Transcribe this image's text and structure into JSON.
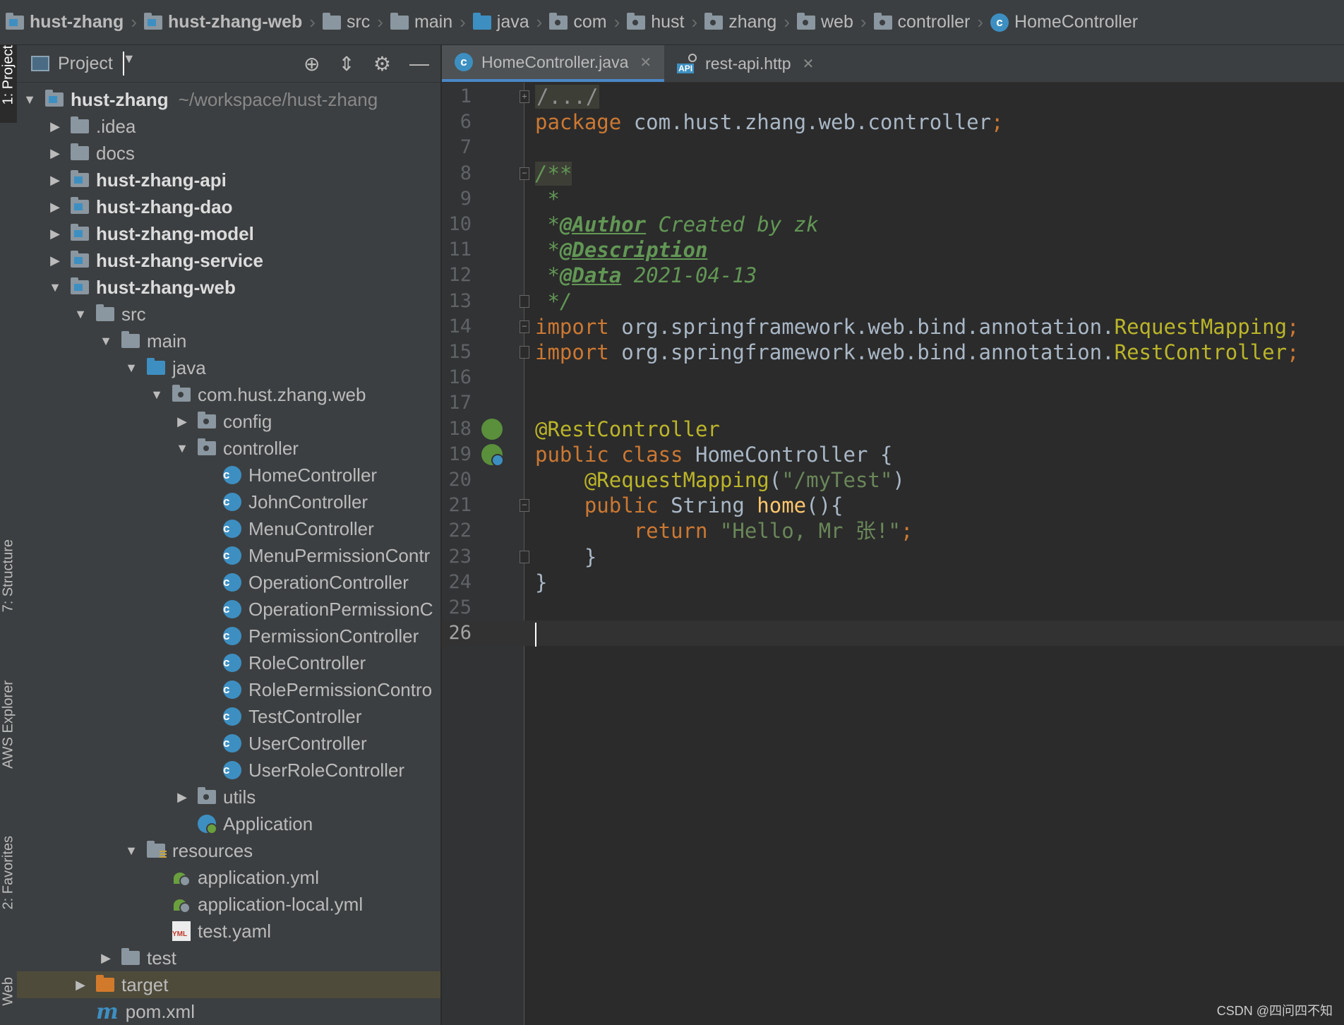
{
  "breadcrumb": [
    {
      "label": "hust-zhang",
      "icon": "module-folder-icon",
      "bold": true
    },
    {
      "label": "hust-zhang-web",
      "icon": "module-folder-icon",
      "bold": true
    },
    {
      "label": "src",
      "icon": "folder-icon"
    },
    {
      "label": "main",
      "icon": "folder-icon"
    },
    {
      "label": "java",
      "icon": "source-folder-icon"
    },
    {
      "label": "com",
      "icon": "package-icon"
    },
    {
      "label": "hust",
      "icon": "package-icon"
    },
    {
      "label": "zhang",
      "icon": "package-icon"
    },
    {
      "label": "web",
      "icon": "package-icon"
    },
    {
      "label": "controller",
      "icon": "package-icon"
    },
    {
      "label": "HomeController",
      "icon": "class-icon"
    }
  ],
  "side_tabs": {
    "project": "1: Project",
    "structure": "7: Structure",
    "aws": "AWS Explorer",
    "favorites": "2: Favorites",
    "web": "Web"
  },
  "project_panel": {
    "title": "Project",
    "tree": [
      {
        "label": "hust-zhang",
        "path": "~/workspace/hust-zhang",
        "depth": 0,
        "arrow": "down",
        "icon": "module",
        "bold": true
      },
      {
        "label": ".idea",
        "depth": 1,
        "arrow": "right",
        "icon": "folder"
      },
      {
        "label": "docs",
        "depth": 1,
        "arrow": "right",
        "icon": "folder"
      },
      {
        "label": "hust-zhang-api",
        "depth": 1,
        "arrow": "right",
        "icon": "module",
        "bold": true
      },
      {
        "label": "hust-zhang-dao",
        "depth": 1,
        "arrow": "right",
        "icon": "module",
        "bold": true
      },
      {
        "label": "hust-zhang-model",
        "depth": 1,
        "arrow": "right",
        "icon": "module",
        "bold": true
      },
      {
        "label": "hust-zhang-service",
        "depth": 1,
        "arrow": "right",
        "icon": "module",
        "bold": true
      },
      {
        "label": "hust-zhang-web",
        "depth": 1,
        "arrow": "down",
        "icon": "module",
        "bold": true
      },
      {
        "label": "src",
        "depth": 2,
        "arrow": "down",
        "icon": "folder"
      },
      {
        "label": "main",
        "depth": 3,
        "arrow": "down",
        "icon": "folder"
      },
      {
        "label": "java",
        "depth": 4,
        "arrow": "down",
        "icon": "source"
      },
      {
        "label": "com.hust.zhang.web",
        "depth": 5,
        "arrow": "down",
        "icon": "package"
      },
      {
        "label": "config",
        "depth": 6,
        "arrow": "right",
        "icon": "package"
      },
      {
        "label": "controller",
        "depth": 6,
        "arrow": "down",
        "icon": "package"
      },
      {
        "label": "HomeController",
        "depth": 7,
        "icon": "class"
      },
      {
        "label": "JohnController",
        "depth": 7,
        "icon": "class"
      },
      {
        "label": "MenuController",
        "depth": 7,
        "icon": "class"
      },
      {
        "label": "MenuPermissionContr",
        "depth": 7,
        "icon": "class"
      },
      {
        "label": "OperationController",
        "depth": 7,
        "icon": "class"
      },
      {
        "label": "OperationPermissionC",
        "depth": 7,
        "icon": "class"
      },
      {
        "label": "PermissionController",
        "depth": 7,
        "icon": "class"
      },
      {
        "label": "RoleController",
        "depth": 7,
        "icon": "class"
      },
      {
        "label": "RolePermissionContro",
        "depth": 7,
        "icon": "class"
      },
      {
        "label": "TestController",
        "depth": 7,
        "icon": "class"
      },
      {
        "label": "UserController",
        "depth": 7,
        "icon": "class"
      },
      {
        "label": "UserRoleController",
        "depth": 7,
        "icon": "class"
      },
      {
        "label": "utils",
        "depth": 6,
        "arrow": "right",
        "icon": "package"
      },
      {
        "label": "Application",
        "depth": 6,
        "icon": "app"
      },
      {
        "label": "resources",
        "depth": 4,
        "arrow": "down",
        "icon": "resources"
      },
      {
        "label": "application.yml",
        "depth": 5,
        "icon": "spring"
      },
      {
        "label": "application-local.yml",
        "depth": 5,
        "icon": "spring"
      },
      {
        "label": "test.yaml",
        "depth": 5,
        "icon": "yml"
      },
      {
        "label": "test",
        "depth": 3,
        "arrow": "right",
        "icon": "folder"
      },
      {
        "label": "target",
        "depth": 2,
        "arrow": "right",
        "icon": "excluded",
        "selected": true
      },
      {
        "label": "pom.xml",
        "depth": 2,
        "icon": "maven"
      }
    ]
  },
  "editor": {
    "tabs": [
      {
        "label": "HomeController.java",
        "icon": "class-icon",
        "active": true
      },
      {
        "label": "rest-api.http",
        "icon": "api-icon",
        "active": false
      }
    ],
    "lines": [
      {
        "n": "1",
        "fold": "+",
        "segs": [
          {
            "t": "/.../",
            "c": "foldbox"
          }
        ]
      },
      {
        "n": "6",
        "segs": [
          {
            "t": "package ",
            "c": "kw"
          },
          {
            "t": "com.hust.zhang.web.controller",
            "c": "plain"
          },
          {
            "t": ";",
            "c": "kw"
          }
        ]
      },
      {
        "n": "7",
        "segs": []
      },
      {
        "n": "8",
        "fold": "-",
        "segs": [
          {
            "t": "/**",
            "c": "cm cmbox"
          }
        ]
      },
      {
        "n": "9",
        "segs": [
          {
            "t": " *",
            "c": "cm"
          }
        ]
      },
      {
        "n": "10",
        "segs": [
          {
            "t": " *",
            "c": "cm"
          },
          {
            "t": "@Author",
            "c": "cmtag"
          },
          {
            "t": " Created by zk",
            "c": "cm"
          }
        ]
      },
      {
        "n": "11",
        "segs": [
          {
            "t": " *",
            "c": "cm"
          },
          {
            "t": "@Description",
            "c": "cmtag"
          }
        ]
      },
      {
        "n": "12",
        "segs": [
          {
            "t": " *",
            "c": "cm"
          },
          {
            "t": "@Data",
            "c": "cmtag"
          },
          {
            "t": " 2021-04-13",
            "c": "cm"
          }
        ]
      },
      {
        "n": "13",
        "fold": "e",
        "segs": [
          {
            "t": " */",
            "c": "cm"
          }
        ]
      },
      {
        "n": "14",
        "fold": "-",
        "segs": [
          {
            "t": "import ",
            "c": "kw"
          },
          {
            "t": "org.springframework.web.bind.annotation.",
            "c": "plain"
          },
          {
            "t": "RequestMapping",
            "c": "ann"
          },
          {
            "t": ";",
            "c": "kw"
          }
        ]
      },
      {
        "n": "15",
        "fold": "e",
        "segs": [
          {
            "t": "import ",
            "c": "kw"
          },
          {
            "t": "org.springframework.web.bind.annotation.",
            "c": "plain"
          },
          {
            "t": "RestController",
            "c": "ann"
          },
          {
            "t": ";",
            "c": "kw"
          }
        ]
      },
      {
        "n": "16",
        "segs": []
      },
      {
        "n": "17",
        "segs": []
      },
      {
        "n": "18",
        "gutter": "bean",
        "segs": [
          {
            "t": "@RestController",
            "c": "ann"
          }
        ]
      },
      {
        "n": "19",
        "gutter": "beanclass",
        "segs": [
          {
            "t": "public class ",
            "c": "kw"
          },
          {
            "t": "HomeController {",
            "c": "plain"
          }
        ]
      },
      {
        "n": "20",
        "segs": [
          {
            "t": "    ",
            "c": "plain"
          },
          {
            "t": "@RequestMapping",
            "c": "ann"
          },
          {
            "t": "(",
            "c": "plain"
          },
          {
            "t": "\"/myTest\"",
            "c": "str"
          },
          {
            "t": ")",
            "c": "plain"
          }
        ]
      },
      {
        "n": "21",
        "fold": "-",
        "segs": [
          {
            "t": "    ",
            "c": "plain"
          },
          {
            "t": "public ",
            "c": "kw"
          },
          {
            "t": "String ",
            "c": "plain"
          },
          {
            "t": "home",
            "c": "fn"
          },
          {
            "t": "(){",
            "c": "plain"
          }
        ]
      },
      {
        "n": "22",
        "segs": [
          {
            "t": "        ",
            "c": "plain"
          },
          {
            "t": "return ",
            "c": "kw"
          },
          {
            "t": "\"Hello, Mr 张!\"",
            "c": "str"
          },
          {
            "t": ";",
            "c": "kw"
          }
        ]
      },
      {
        "n": "23",
        "fold": "e",
        "segs": [
          {
            "t": "    }",
            "c": "plain"
          }
        ]
      },
      {
        "n": "24",
        "segs": [
          {
            "t": "}",
            "c": "plain"
          }
        ]
      },
      {
        "n": "25",
        "segs": []
      },
      {
        "n": "26",
        "current": true,
        "caret": true,
        "segs": []
      }
    ]
  },
  "watermark": "CSDN @四问四不知",
  "colors": {
    "keyword": "#cc7832",
    "annotation": "#bbb529",
    "string": "#6a8759",
    "comment": "#629755",
    "method": "#ffc66d",
    "accent": "#4a88c7"
  }
}
